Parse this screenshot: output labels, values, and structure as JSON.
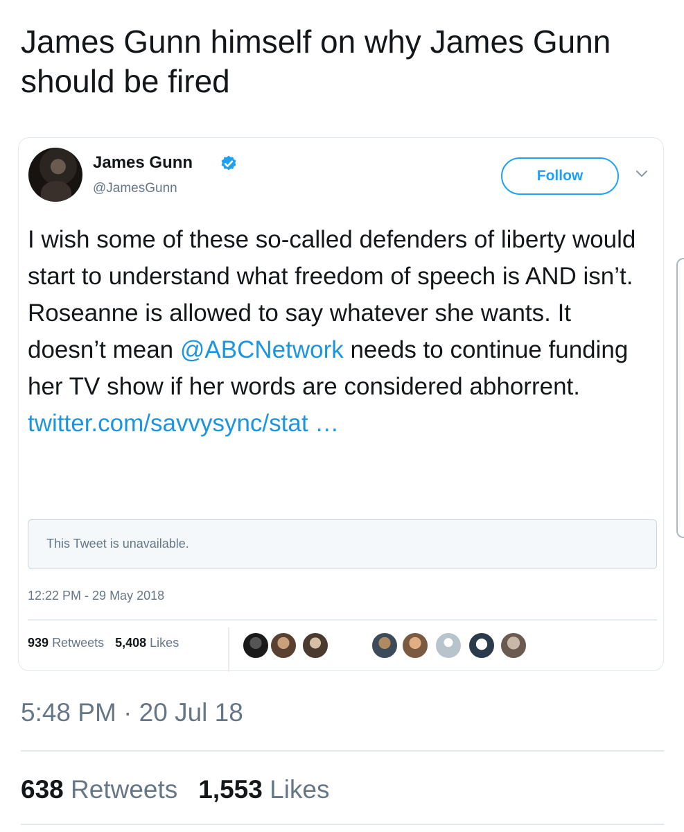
{
  "post": {
    "title": "James Gunn himself on why James Gunn should be fired"
  },
  "embedded_tweet": {
    "author_name": "James Gunn",
    "author_handle": "@JamesGunn",
    "follow_label": "Follow",
    "text_before_mention": "I wish some of these so-called defenders of liberty would start to understand what freedom of speech is AND isn’t. Roseanne is allowed to say whatever she wants. It doesn’t mean ",
    "mention": "@ABCNetwork",
    "text_after_mention": " needs to continue funding her TV show if her words are considered abhorrent.",
    "link": "twitter.com/savvysync/stat …",
    "quote_unavailable": "This Tweet is unavailable.",
    "timestamp": "12:22 PM - 29 May 2018",
    "retweets_count": "939",
    "retweets_label": "Retweets",
    "likes_count": "5,408",
    "likes_label": "Likes"
  },
  "outer": {
    "timestamp": "5:48 PM · 20 Jul 18",
    "retweets_count": "638",
    "retweets_label": "Retweets",
    "likes_count": "1,553",
    "likes_label": "Likes"
  },
  "colors": {
    "link_blue": "#1b95e0",
    "follow_blue": "#1da1f2",
    "muted_gray": "#657786",
    "text_dark": "#14171a"
  }
}
